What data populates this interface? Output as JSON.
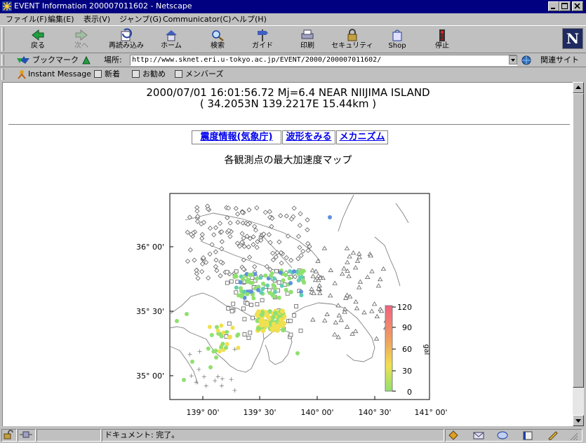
{
  "window": {
    "title": "EVENT Information 200007011602 - Netscape",
    "controls": [
      "minimize",
      "maximize",
      "close"
    ]
  },
  "menu": {
    "items": [
      "ファイル(F)",
      "編集(E)",
      "表示(V)",
      "ジャンプ(G)",
      "Communicator(C)",
      "ヘルプ(H)"
    ]
  },
  "toolbar": {
    "back": "戻る",
    "forward": "次へ",
    "reload": "再読み込み",
    "home": "ホーム",
    "search": "検索",
    "guide": "ガイド",
    "print": "印刷",
    "security": "セキュリティ",
    "shop": "Shop",
    "stop": "停止"
  },
  "location": {
    "bookmarks": "ブックマーク",
    "label": "場所:",
    "url": "http://www.sknet.eri.u-tokyo.ac.jp/EVENT/2000/200007011602/",
    "related": "関連サイト"
  },
  "personal": {
    "items": [
      "Instant Message",
      "新着",
      "お勧め",
      "メンバーズ"
    ]
  },
  "page": {
    "line1": "2000/07/01 16:01:56.72 Mj=6.4 NEAR NIIJIMA ISLAND",
    "line2": "( 34.2053N 139.2217E 15.44km )",
    "links": [
      "震度情報(気象庁)",
      "波形をみる",
      "メカニズム"
    ],
    "map_title": "各観測点の最大加速度マップ"
  },
  "chart_data": {
    "type": "scatter",
    "x_ticks": [
      "139° 00'",
      "139° 30'",
      "140° 00'",
      "140° 30'",
      "141° 00'"
    ],
    "y_ticks": [
      "36° 00'",
      "35° 30'",
      "35° 00'"
    ],
    "colorbar": {
      "ticks": [
        "120",
        "90",
        "60",
        "30",
        "0"
      ],
      "unit": "gal",
      "range": [
        0,
        120
      ],
      "colors": [
        "#90e070",
        "#f0e050",
        "#f0a060",
        "#f06080"
      ]
    },
    "station_colors": {
      "low": "#90e070",
      "mid": "#f0e050",
      "blue": "#6090e0",
      "cyan": "#60d0b0"
    }
  },
  "status": {
    "text": "ドキュメント: 完了。"
  }
}
